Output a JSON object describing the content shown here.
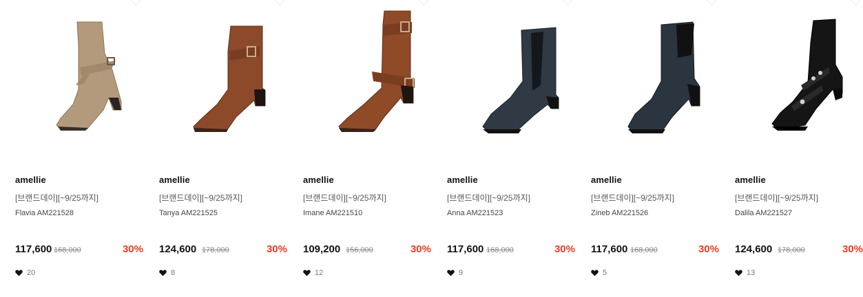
{
  "products": [
    {
      "brand": "amellie",
      "promo": "[브랜드데이][~9/25까지]",
      "name": "Flavia AM221528",
      "price": "117,600",
      "original_price": "168,000",
      "discount": "30%",
      "likes": "20",
      "boot_color": "#b49a7d",
      "style": "strap-mid"
    },
    {
      "brand": "amellie",
      "promo": "[브랜드데이][~9/25까지]",
      "name": "Tanya AM221525",
      "price": "124,600",
      "original_price": "178,000",
      "discount": "30%",
      "likes": "8",
      "boot_color": "#8c4a2b",
      "style": "single-buckle"
    },
    {
      "brand": "amellie",
      "promo": "[브랜드데이][~9/25까지]",
      "name": "Imane AM221510",
      "price": "109,200",
      "original_price": "156,000",
      "discount": "30%",
      "likes": "12",
      "boot_color": "#8f4a28",
      "style": "double-buckle"
    },
    {
      "brand": "amellie",
      "promo": "[브랜드데이][~9/25까지]",
      "name": "Anna AM221523",
      "price": "117,600",
      "original_price": "168,000",
      "discount": "30%",
      "likes": "9",
      "boot_color": "#2f3a45",
      "style": "chelsea"
    },
    {
      "brand": "amellie",
      "promo": "[브랜드데이][~9/25까지]",
      "name": "Zineb AM221526",
      "price": "117,600",
      "original_price": "168,000",
      "discount": "30%",
      "likes": "5",
      "boot_color": "#2b3540",
      "style": "block-heel"
    },
    {
      "brand": "amellie",
      "promo": "[브랜드데이][~9/25까지]",
      "name": "Dalila AM221527",
      "price": "124,600",
      "original_price": "178,000",
      "discount": "30%",
      "likes": "13",
      "boot_color": "#151515",
      "style": "velvet-studs"
    }
  ],
  "colors": {
    "discount": "#ee3a23",
    "price": "#111111",
    "original_price": "#888888",
    "heart": "#111111"
  },
  "icons": {
    "like": "heart-icon"
  }
}
